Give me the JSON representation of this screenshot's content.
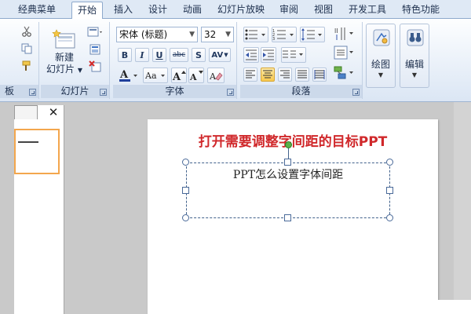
{
  "tabs": [
    "经典菜单",
    "开始",
    "插入",
    "设计",
    "动画",
    "幻灯片放映",
    "审阅",
    "视图",
    "开发工具",
    "特色功能"
  ],
  "active_tab": "开始",
  "groups": {
    "clipboard": {
      "label": "板"
    },
    "slides": {
      "label": "幻灯片",
      "new_slide_line1": "新建",
      "new_slide_line2": "幻灯片"
    },
    "font": {
      "label": "字体",
      "font_name": "宋体 (标题)",
      "font_size": "32"
    },
    "paragraph": {
      "label": "段落"
    },
    "drawing": {
      "label": "绘图"
    },
    "editing": {
      "label": "编辑"
    }
  },
  "font_buttons": [
    "B",
    "I",
    "U",
    "abc",
    "S",
    "AV"
  ],
  "slide": {
    "title": "打开需要调整字间距的目标PPT",
    "textbox_text": "PPT怎么设置字体间距"
  },
  "colors": {
    "title_red": "#d0282b",
    "thumb_border": "#f3a64d",
    "ribbon_blue": "#dfe9f5"
  }
}
